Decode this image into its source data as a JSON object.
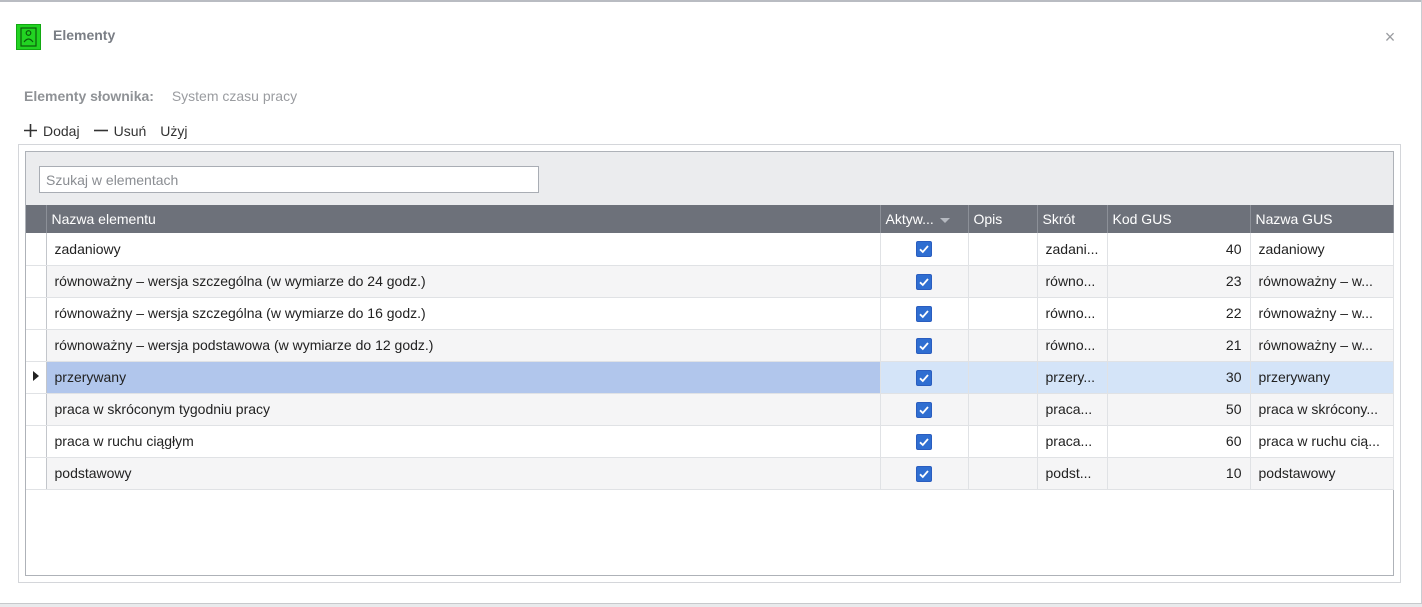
{
  "window": {
    "title": "Elementy",
    "close_glyph": "×"
  },
  "dictionary": {
    "label": "Elementy słownika:",
    "value": "System czasu pracy"
  },
  "toolbar": {
    "add_label": "Dodaj",
    "remove_label": "Usuń",
    "use_label": "Użyj"
  },
  "search": {
    "placeholder": "Szukaj w elementach"
  },
  "grid": {
    "columns": [
      "Nazwa elementu",
      "Aktyw...",
      "Opis",
      "Skrót",
      "Kod GUS",
      "Nazwa GUS"
    ],
    "rows": [
      {
        "name": "zadaniowy",
        "active": true,
        "desc": "",
        "short": "zadani...",
        "gus_code": "40",
        "gus_name": "zadaniowy"
      },
      {
        "name": "równoważny – wersja szczególna (w wymiarze do 24 godz.)",
        "active": true,
        "desc": "",
        "short": "równo...",
        "gus_code": "23",
        "gus_name": "równoważny – w..."
      },
      {
        "name": "równoważny – wersja szczególna (w wymiarze do 16 godz.)",
        "active": true,
        "desc": "",
        "short": "równo...",
        "gus_code": "22",
        "gus_name": "równoważny – w..."
      },
      {
        "name": "równoważny – wersja podstawowa (w wymiarze do 12 godz.)",
        "active": true,
        "desc": "",
        "short": "równo...",
        "gus_code": "21",
        "gus_name": "równoważny – w..."
      },
      {
        "name": "przerywany",
        "active": true,
        "desc": "",
        "short": "przery...",
        "gus_code": "30",
        "gus_name": "przerywany",
        "selected": true
      },
      {
        "name": "praca w skróconym tygodniu pracy",
        "active": true,
        "desc": "",
        "short": "praca...",
        "gus_code": "50",
        "gus_name": "praca w skrócony..."
      },
      {
        "name": "praca w ruchu ciągłym",
        "active": true,
        "desc": "",
        "short": "praca...",
        "gus_code": "60",
        "gus_name": "praca w ruchu cią..."
      },
      {
        "name": "podstawowy",
        "active": true,
        "desc": "",
        "short": "podst...",
        "gus_code": "10",
        "gus_name": "podstawowy"
      }
    ]
  },
  "colors": {
    "header_bg": "#6d717a",
    "selected_row": "#d4e4f8",
    "selected_cell": "#b1c6ec",
    "checkbox": "#2f6ed1",
    "app_icon": "#22d322"
  },
  "icons": {
    "app": "app-logo-icon",
    "close": "close-icon",
    "add": "plus-icon",
    "remove": "minus-icon",
    "row_indicator": "row-pointer-icon",
    "sort": "sort-dropdown-icon"
  }
}
